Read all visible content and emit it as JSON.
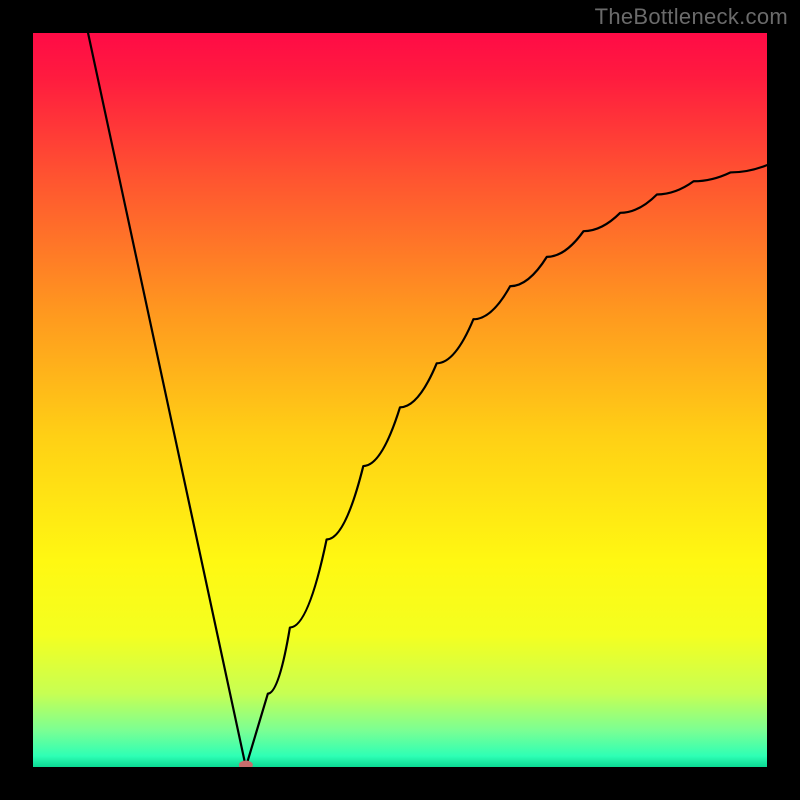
{
  "watermark": "TheBottleneck.com",
  "chart_data": {
    "type": "line",
    "title": "",
    "xlabel": "",
    "ylabel": "",
    "x_range": [
      0,
      100
    ],
    "y_range": [
      0,
      100
    ],
    "curve_description": "V-shaped bottleneck curve: steep linear descent from top-left to a single minimum near x≈29, then a concave-down ascent toward the right edge reaching roughly y≈82 at x=100.",
    "minimum": {
      "x": 29,
      "y": 0
    },
    "left_branch": [
      {
        "x": 7.5,
        "y": 100
      },
      {
        "x": 29,
        "y": 0
      }
    ],
    "right_branch": [
      {
        "x": 29,
        "y": 0
      },
      {
        "x": 32,
        "y": 10
      },
      {
        "x": 35,
        "y": 19
      },
      {
        "x": 40,
        "y": 31
      },
      {
        "x": 45,
        "y": 41
      },
      {
        "x": 50,
        "y": 49
      },
      {
        "x": 55,
        "y": 55
      },
      {
        "x": 60,
        "y": 61
      },
      {
        "x": 65,
        "y": 65.5
      },
      {
        "x": 70,
        "y": 69.5
      },
      {
        "x": 75,
        "y": 73
      },
      {
        "x": 80,
        "y": 75.5
      },
      {
        "x": 85,
        "y": 78
      },
      {
        "x": 90,
        "y": 79.8
      },
      {
        "x": 95,
        "y": 81
      },
      {
        "x": 100,
        "y": 82
      }
    ],
    "marker": {
      "x": 29,
      "y": 0,
      "color": "#c96c6c"
    },
    "background_gradient": {
      "type": "vertical",
      "stops": [
        {
          "offset": 0.0,
          "color": "#ff0b46"
        },
        {
          "offset": 0.06,
          "color": "#ff1b3f"
        },
        {
          "offset": 0.2,
          "color": "#ff5530"
        },
        {
          "offset": 0.38,
          "color": "#ff981f"
        },
        {
          "offset": 0.55,
          "color": "#ffd015"
        },
        {
          "offset": 0.72,
          "color": "#fff812"
        },
        {
          "offset": 0.82,
          "color": "#f4ff20"
        },
        {
          "offset": 0.9,
          "color": "#c7ff53"
        },
        {
          "offset": 0.95,
          "color": "#7bff93"
        },
        {
          "offset": 0.985,
          "color": "#2effb5"
        },
        {
          "offset": 1.0,
          "color": "#0bd993"
        }
      ]
    }
  }
}
